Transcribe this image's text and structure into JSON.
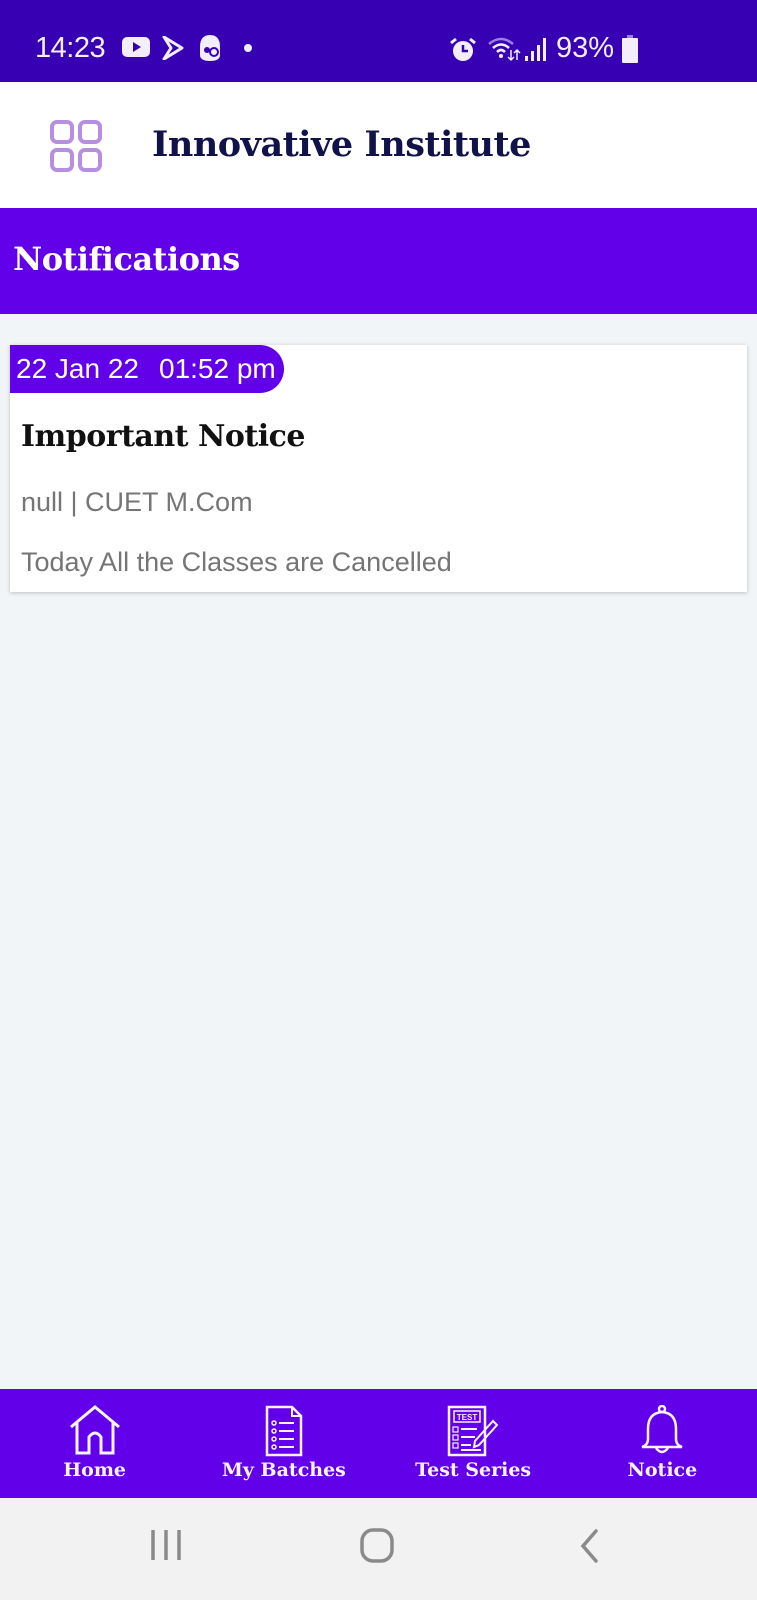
{
  "status_bar": {
    "time": "14:23",
    "left_icons": [
      "youtube-icon",
      "play-store-icon",
      "app-notification-icon",
      "dot-icon"
    ],
    "right_icons": [
      "alarm-icon",
      "wifi-icon",
      "signal-icon",
      "battery-icon"
    ],
    "battery_percent": "93%"
  },
  "header": {
    "menu_icon": "grid-menu-icon",
    "title": "Innovative Institute"
  },
  "page": {
    "title": "Notifications"
  },
  "notifications": [
    {
      "date": "22 Jan 22",
      "time": "01:52 pm",
      "title": "Important Notice",
      "meta": "null | CUET M.Com",
      "body": "Today All the Classes are Cancelled"
    }
  ],
  "bottom_nav": {
    "items": [
      {
        "label": "Home",
        "icon": "home-icon"
      },
      {
        "label": "My Batches",
        "icon": "batches-icon"
      },
      {
        "label": "Test Series",
        "icon": "test-series-icon"
      },
      {
        "label": "Notice",
        "icon": "bell-icon"
      }
    ],
    "active": "Notice"
  },
  "system_nav": {
    "buttons": [
      "recent-apps",
      "home",
      "back"
    ]
  },
  "colors": {
    "status_bar": "#3700b3",
    "primary": "#6200ea",
    "title_text": "#12124a",
    "menu_icon": "#b68fe0",
    "background": "#f1f5f7",
    "secondary_text": "#757575"
  }
}
